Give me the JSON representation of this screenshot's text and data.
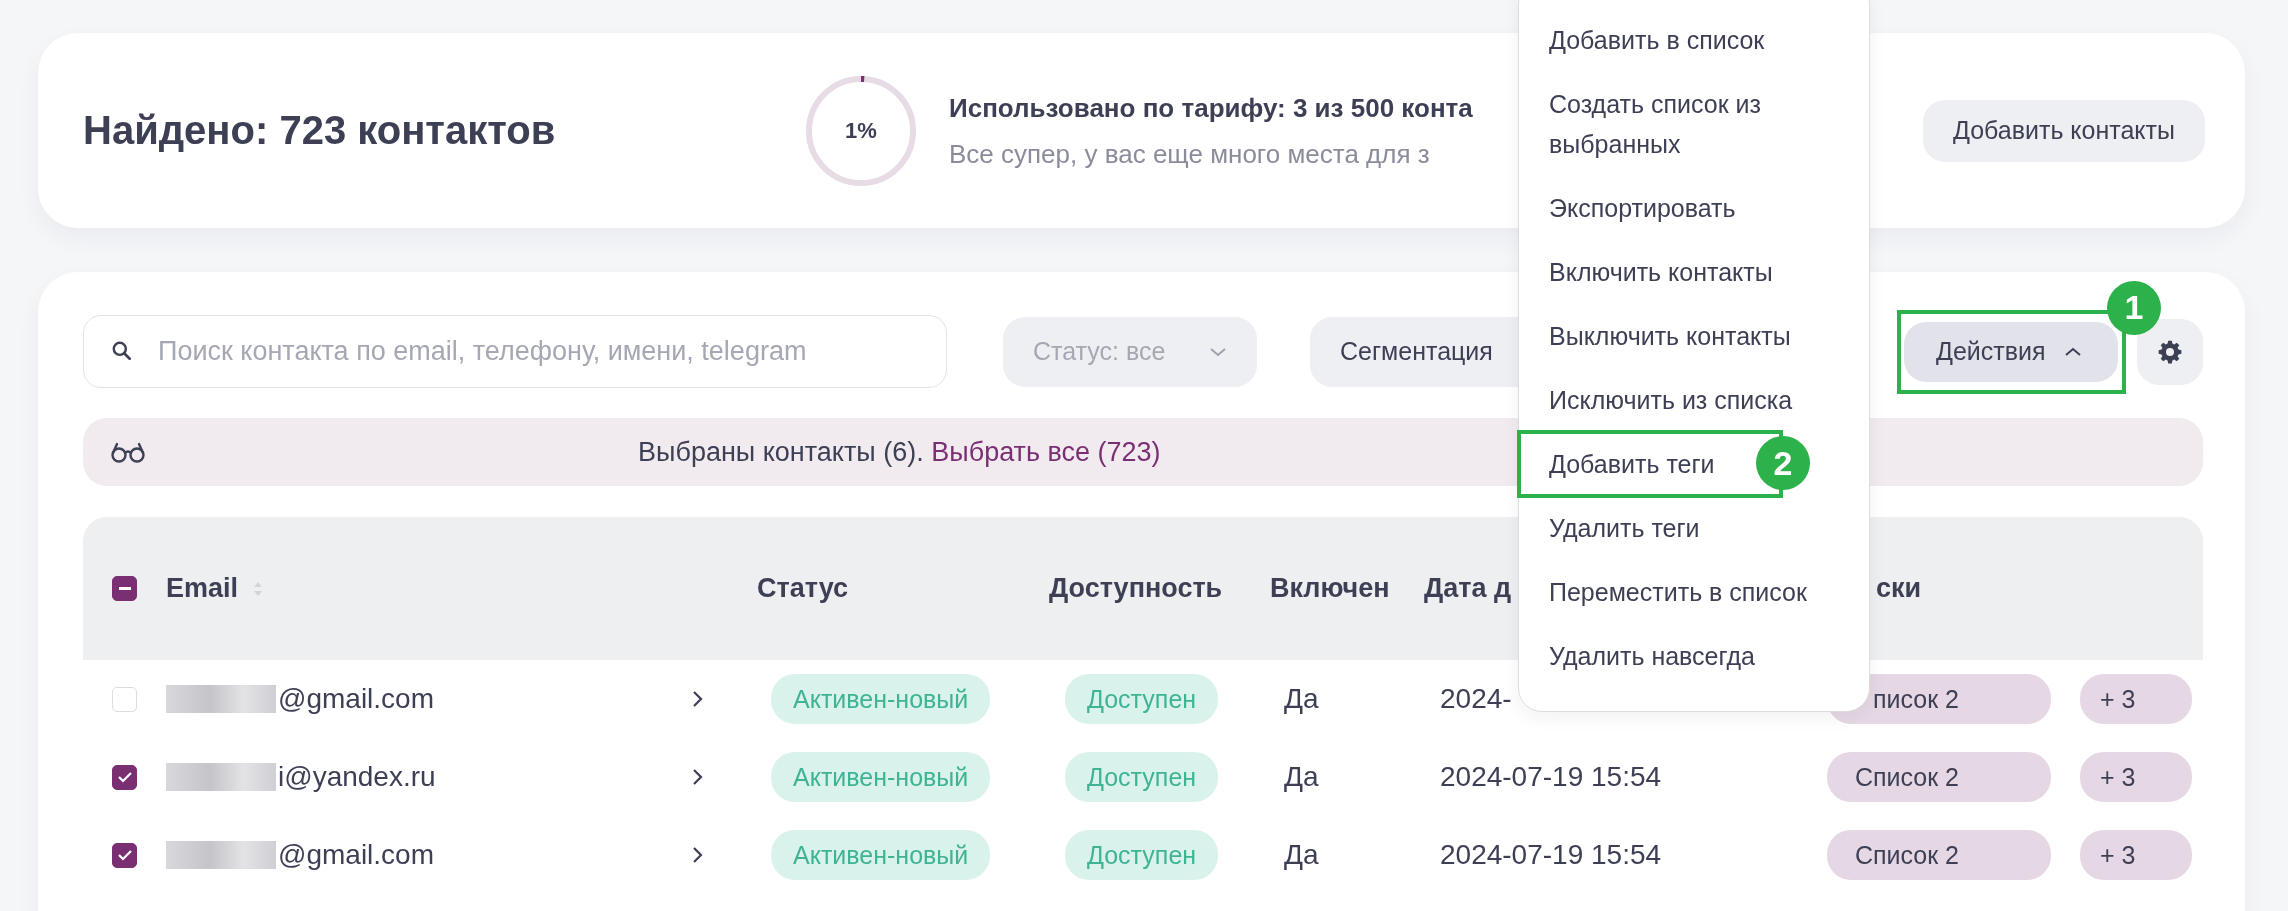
{
  "summary": {
    "title": "Найдено: 723 контактов",
    "usage": {
      "level": 0.01,
      "percent": "1%",
      "line_1": "Использовано по тарифу: 3 из 500 конта",
      "line_2": "Все супер, у вас еще много места для з"
    },
    "add_button": "Добавить контакты"
  },
  "toolbar": {
    "search": {
      "placeholder": "Поиск контакта по email, телефону, имени, telegram"
    },
    "status_filter": {
      "label": "Статус: все",
      "disabled": true
    },
    "segment_button": "Сегментация",
    "actions_button": {
      "label": "Действия",
      "expanded": true,
      "annotation": "1"
    }
  },
  "selection_banner": {
    "text": "Выбраны контакты (6). ",
    "link": "Выбрать все (723)"
  },
  "table": {
    "select_all": {
      "checked": true,
      "indeterminate": true
    },
    "columns": [
      {
        "label": "Email",
        "sortable": true
      },
      {
        "label": "Статус",
        "sortable": false
      },
      {
        "label": "Доступность",
        "sortable": false
      },
      {
        "label": "Включен",
        "sortable": false
      },
      {
        "label": "Дата д",
        "sortable": false
      },
      {
        "label": "ски",
        "sortable": false
      }
    ],
    "rows": [
      {
        "checked": false,
        "email": "@gmail.com",
        "status": "Активен-новый",
        "availability": "Доступен",
        "enabled": "Да",
        "date": "2024-",
        "list": "писок 2",
        "more": "+ 3"
      },
      {
        "checked": true,
        "email": "i@yandex.ru",
        "status": "Активен-новый",
        "availability": "Доступен",
        "enabled": "Да",
        "date": "2024-07-19 15:54",
        "list": "Список 2",
        "more": "+ 3"
      },
      {
        "checked": true,
        "email": "@gmail.com",
        "status": "Активен-новый",
        "availability": "Доступен",
        "enabled": "Да",
        "date": "2024-07-19 15:54",
        "list": "Список 2",
        "more": "+ 3"
      }
    ]
  },
  "actions_menu": {
    "items": [
      {
        "label": "Добавить в список"
      },
      {
        "label": "Создать список из выбранных"
      },
      {
        "label": "Экспортировать"
      },
      {
        "label": "Включить контакты"
      },
      {
        "label": "Выключить контакты"
      },
      {
        "label": "Исключить из списка"
      },
      {
        "label": "Добавить теги",
        "annotation": "2"
      },
      {
        "label": "Удалить теги"
      },
      {
        "label": "Переместить в список"
      },
      {
        "label": "Удалить навсегда"
      }
    ]
  }
}
